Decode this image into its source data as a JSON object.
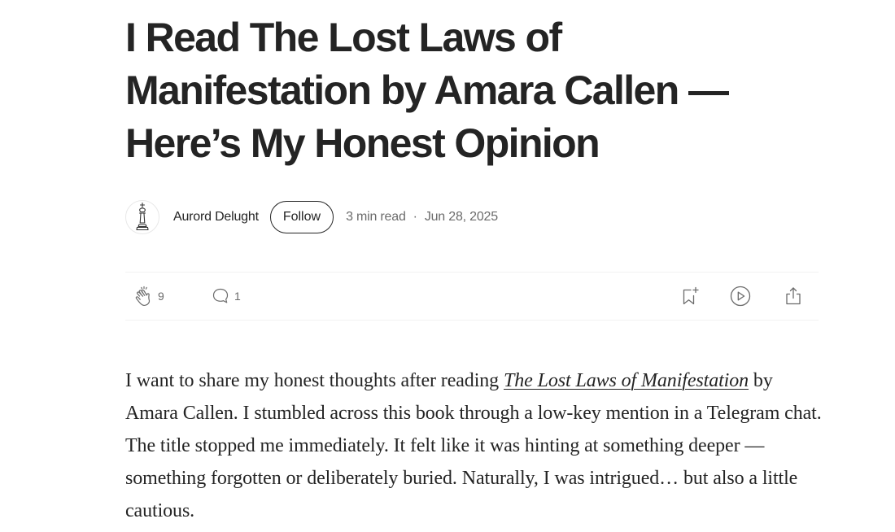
{
  "article": {
    "title": "I Read The Lost Laws of Manifestation by Amara Callen — Here’s My Honest Opinion",
    "author": {
      "name": "Aurord Delught",
      "avatar_icon": "chess-king-icon"
    },
    "follow_label": "Follow",
    "read_time": "3 min read",
    "separator": "·",
    "date": "Jun 28, 2025",
    "actions": {
      "claps": "9",
      "responses": "1"
    },
    "body": {
      "intro": "I want to share my honest thoughts after reading ",
      "book_title": "The Lost Laws of Manifestation",
      "rest": " by Amara Callen. I stumbled across this book through a low-key mention in a Telegram chat. The title stopped me immediately. It felt like it was hinting at something deeper — something forgotten or deliberately buried. Naturally, I was intrigued… but also a little cautious."
    }
  },
  "colors": {
    "text": "#242424",
    "muted": "#6b6b6b",
    "divider": "#f2f2f2"
  }
}
